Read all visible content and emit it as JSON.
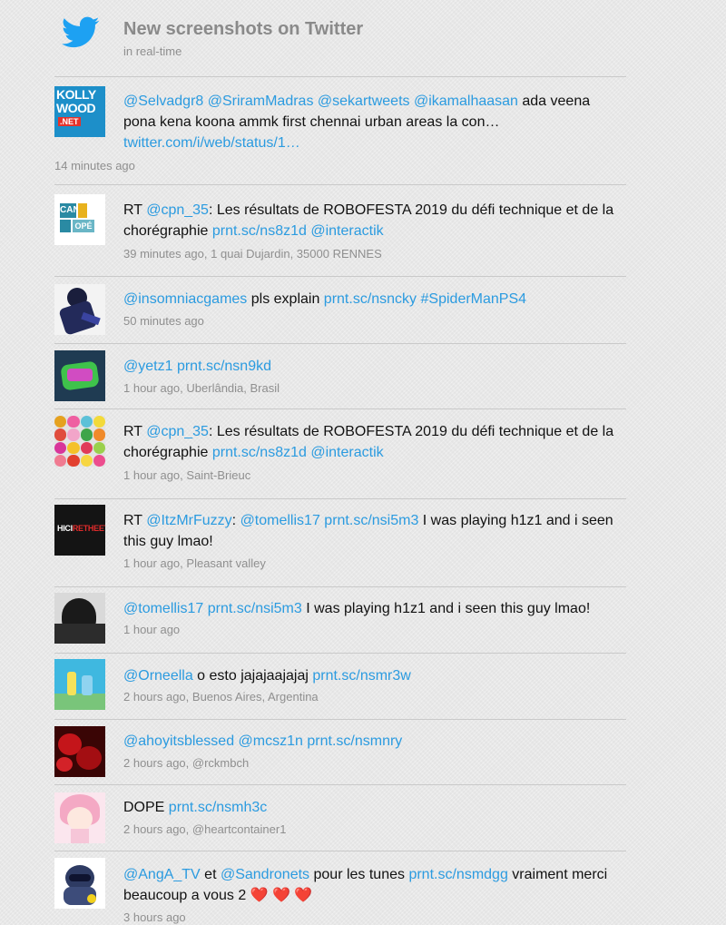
{
  "header": {
    "title": "New screenshots on Twitter",
    "subtitle": "in real-time"
  },
  "tweets": [
    {
      "avatar": "kollywood-logo-avatar",
      "parts": [
        {
          "t": "@Selvadgr8",
          "link": true
        },
        {
          "t": " "
        },
        {
          "t": "@SriramMadras",
          "link": true
        },
        {
          "t": " "
        },
        {
          "t": "@sekartweets",
          "link": true
        },
        {
          "t": " "
        },
        {
          "t": "@ikamalhaasan",
          "link": true
        },
        {
          "t": " ada veena pona kena koona ammk first chennai urban areas la con… "
        },
        {
          "t": "twitter.com/i/web/status/1…",
          "link": true
        }
      ],
      "time": "14 minutes ago",
      "location": ""
    },
    {
      "avatar": "canope-logo-avatar",
      "parts": [
        {
          "t": "RT "
        },
        {
          "t": "@cpn_35",
          "link": true
        },
        {
          "t": ": Les résultats de ROBOFESTA 2019 du défi technique et de la chorégraphie "
        },
        {
          "t": "prnt.sc/ns8z1d",
          "link": true
        },
        {
          "t": " "
        },
        {
          "t": "@interactik",
          "link": true
        }
      ],
      "time": "39 minutes ago",
      "location": "1 quai Dujardin, 35000 RENNES"
    },
    {
      "avatar": "game-character-avatar",
      "parts": [
        {
          "t": "@insomniacgames",
          "link": true
        },
        {
          "t": " pls explain "
        },
        {
          "t": "prnt.sc/nsncky",
          "link": true
        },
        {
          "t": " "
        },
        {
          "t": "#SpiderManPS4",
          "link": true
        }
      ],
      "time": "50 minutes ago",
      "location": ""
    },
    {
      "avatar": "graffiti-art-avatar",
      "parts": [
        {
          "t": "@yetz1",
          "link": true
        },
        {
          "t": " "
        },
        {
          "t": "prnt.sc/nsn9kd",
          "link": true
        }
      ],
      "time": "1 hour ago",
      "location": "Uberlândia, Brasil"
    },
    {
      "avatar": "colored-yarn-avatar",
      "parts": [
        {
          "t": "RT "
        },
        {
          "t": "@cpn_35",
          "link": true
        },
        {
          "t": ": Les résultats de ROBOFESTA 2019 du défi technique et de la chorégraphie "
        },
        {
          "t": "prnt.sc/ns8z1d",
          "link": true
        },
        {
          "t": " "
        },
        {
          "t": "@interactik",
          "link": true
        }
      ],
      "time": "1 hour ago",
      "location": "Saint-Brieuc"
    },
    {
      "avatar": "dark-logo-avatar",
      "parts": [
        {
          "t": "RT "
        },
        {
          "t": "@ItzMrFuzzy",
          "link": true
        },
        {
          "t": ": "
        },
        {
          "t": "@tomellis17",
          "link": true
        },
        {
          "t": " "
        },
        {
          "t": "prnt.sc/nsi5m3",
          "link": true
        },
        {
          "t": " I was playing h1z1 and i seen this guy lmao!"
        }
      ],
      "time": "1 hour ago",
      "location": "Pleasant valley"
    },
    {
      "avatar": "dark-portrait-avatar",
      "parts": [
        {
          "t": "@tomellis17",
          "link": true
        },
        {
          "t": " "
        },
        {
          "t": "prnt.sc/nsi5m3",
          "link": true
        },
        {
          "t": " I was playing h1z1 and i seen this guy lmao!"
        }
      ],
      "time": "1 hour ago",
      "location": ""
    },
    {
      "avatar": "cartoon-scene-avatar",
      "parts": [
        {
          "t": "@Orneella",
          "link": true
        },
        {
          "t": " o esto jajajaajajaj "
        },
        {
          "t": "prnt.sc/nsmr3w",
          "link": true
        }
      ],
      "time": "2 hours ago",
      "location": "Buenos Aires, Argentina"
    },
    {
      "avatar": "red-roses-avatar",
      "parts": [
        {
          "t": "@ahoyitsblessed",
          "link": true
        },
        {
          "t": " "
        },
        {
          "t": "@mcsz1n",
          "link": true
        },
        {
          "t": " "
        },
        {
          "t": "prnt.sc/nsmnry",
          "link": true
        }
      ],
      "time": "2 hours ago",
      "location": "@rckmbch"
    },
    {
      "avatar": "anime-girl-avatar",
      "parts": [
        {
          "t": "DOPE "
        },
        {
          "t": "prnt.sc/nsmh3c",
          "link": true
        }
      ],
      "time": "2 hours ago",
      "location": "@heartcontainer1"
    },
    {
      "avatar": "raccoon-mascot-avatar",
      "parts": [
        {
          "t": "@AngA_TV",
          "link": true
        },
        {
          "t": " et "
        },
        {
          "t": "@Sandronets",
          "link": true
        },
        {
          "t": " pour les tunes "
        },
        {
          "t": "prnt.sc/nsmdgg",
          "link": true
        },
        {
          "t": " vraiment merci beaucoup a vous 2 "
        },
        {
          "t": "❤️ ❤️ ❤️",
          "heart": true
        }
      ],
      "time": "3 hours ago",
      "location": ""
    }
  ],
  "colors": {
    "link": "#2b9be0",
    "muted": "#8f8f8f",
    "title": "#8a8a8a",
    "twitter_blue": "#1da1f2"
  }
}
